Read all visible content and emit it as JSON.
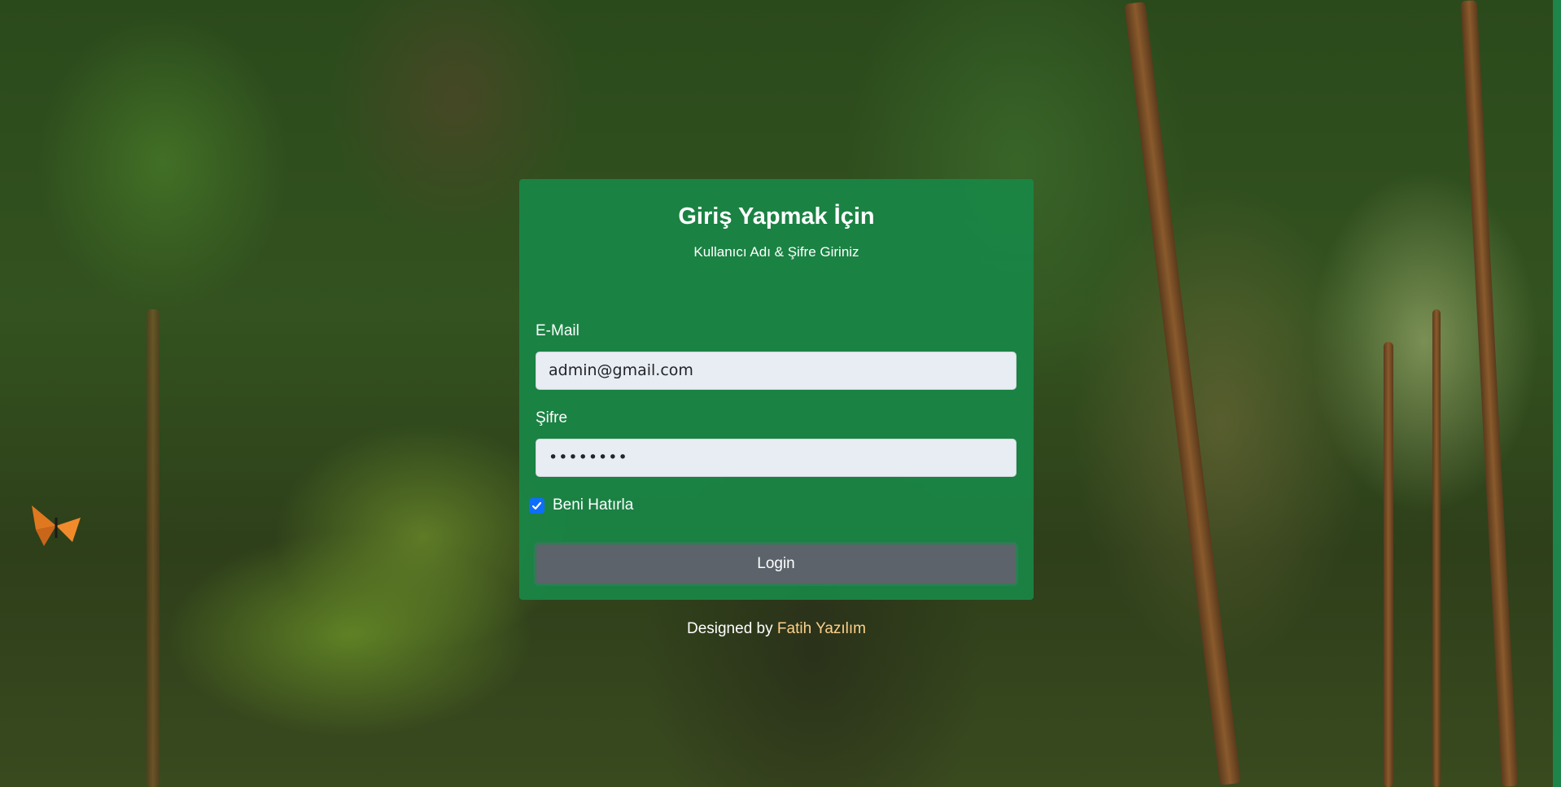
{
  "login_card": {
    "title": "Giriş Yapmak İçin",
    "subtitle": "Kullanıcı Adı & Şifre Giriniz",
    "email_label": "E-Mail",
    "email_value": "admin@gmail.com",
    "password_label": "Şifre",
    "password_value": "••••••••",
    "remember_label": "Beni Hatırla",
    "remember_checked": true,
    "login_button": "Login"
  },
  "footer": {
    "designed_by": "Designed by",
    "author": "Fatih Yazılım"
  },
  "colors": {
    "card": "#198746",
    "button": "#5c636a",
    "checkbox": "#0d6efd",
    "link": "#ffd08a"
  },
  "icons": {
    "checkbox": "check-icon"
  }
}
